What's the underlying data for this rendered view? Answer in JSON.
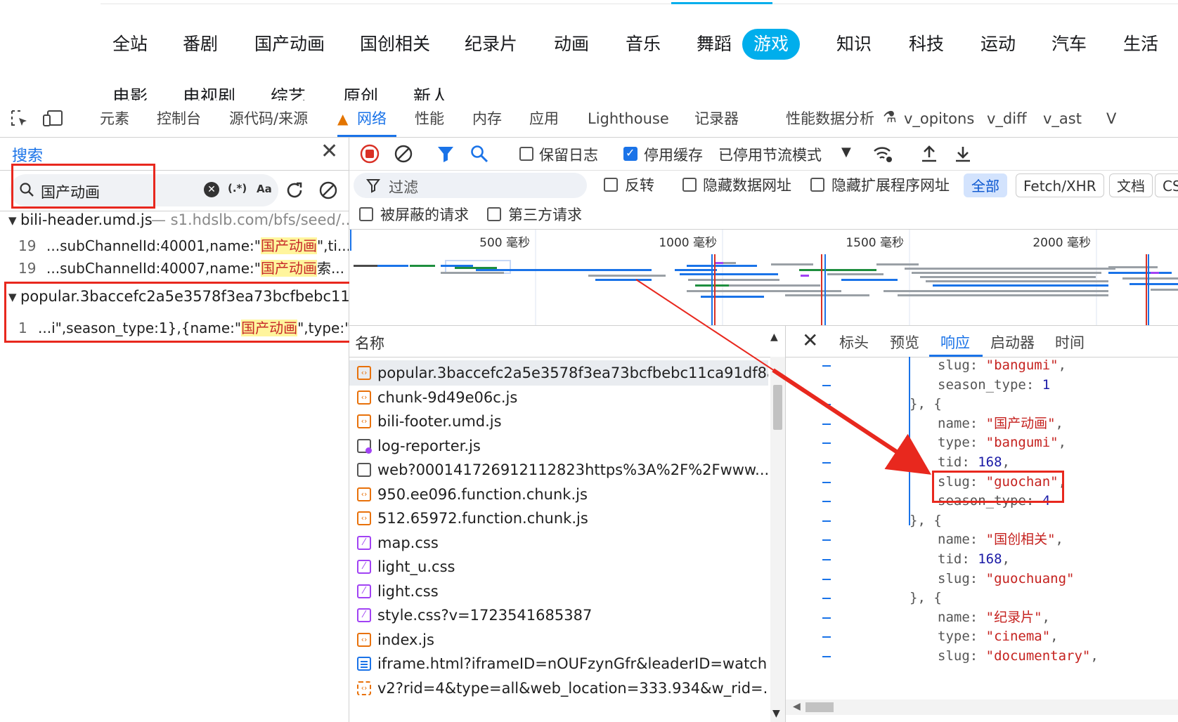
{
  "site_nav": {
    "row1": [
      "全站",
      "番剧",
      "国产动画",
      "国创相关",
      "纪录片",
      "动画",
      "音乐",
      "舞蹈",
      "游戏",
      "知识",
      "科技",
      "运动",
      "汽车",
      "生活"
    ],
    "active": "游戏",
    "row2": [
      "电影",
      "电视剧",
      "综艺",
      "原创",
      "新人"
    ]
  },
  "devtools_tabs": [
    "元素",
    "控制台",
    "源代码/来源",
    "网络",
    "性能",
    "内存",
    "应用",
    "Lighthouse",
    "记录器",
    "性能数据分析",
    "v_opitons",
    "v_diff",
    "v_ast",
    "V"
  ],
  "search_panel": {
    "title": "搜索",
    "query": "国产动画",
    "regex_label": "(.*)",
    "case_label": "Aa",
    "results": [
      {
        "file": "bili-header.umd.js",
        "source": "— s1.hdslb.com/bfs/seed/...",
        "lines": [
          {
            "no": "19",
            "pre": "...subChannelId:40001,name:\"",
            "match": "国产动画",
            "post": "\",ti..."
          },
          {
            "no": "19",
            "pre": "...subChannelId:40007,name:\"",
            "match": "国产动画",
            "post": "索..."
          }
        ]
      },
      {
        "file": "popular.3baccefc2a5e3578f3ea73bcfbebc11c...",
        "source": "",
        "lines": [
          {
            "no": "1",
            "pre": "...i\",season_type:1},{name:\"",
            "match": "国产动画",
            "post": "\",type:\"..."
          }
        ]
      }
    ]
  },
  "network": {
    "toolbar": {
      "preserve_log": "保留日志",
      "disable_cache": "停用缓存",
      "throttle": "已停用节流模式"
    },
    "filter": {
      "placeholder": "过滤",
      "invert": "反转",
      "hide_data": "隐藏数据网址",
      "hide_ext": "隐藏扩展程序网址",
      "types": [
        "全部",
        "Fetch/XHR",
        "文档",
        "CS"
      ],
      "blocked": "被屏蔽的请求",
      "third_party": "第三方请求"
    },
    "timeline_ticks": [
      "500 毫秒",
      "1000 毫秒",
      "1500 毫秒",
      "2000 毫秒"
    ],
    "name_header": "名称",
    "requests": [
      {
        "name": "popular.3baccefc2a5e3578f3ea73bcfbebc11ca91df8a...",
        "icon": "js"
      },
      {
        "name": "chunk-9d49e06c.js",
        "icon": "js"
      },
      {
        "name": "bili-footer.umd.js",
        "icon": "js"
      },
      {
        "name": "log-reporter.js",
        "icon": "doc"
      },
      {
        "name": "web?000141726912112823https%3A%2F%2Fwww....",
        "icon": "blank"
      },
      {
        "name": "950.ee096.function.chunk.js",
        "icon": "js"
      },
      {
        "name": "512.65972.function.chunk.js",
        "icon": "js"
      },
      {
        "name": "map.css",
        "icon": "css"
      },
      {
        "name": "light_u.css",
        "icon": "css"
      },
      {
        "name": "light.css",
        "icon": "css"
      },
      {
        "name": "style.css?v=1723541685387",
        "icon": "css"
      },
      {
        "name": "index.js",
        "icon": "js"
      },
      {
        "name": "iframe.html?iframeID=nOUFzynGfr&leaderID=watch...",
        "icon": "html"
      },
      {
        "name": "v2?rid=4&type=all&web_location=333.934&w_rid=...",
        "icon": "fetch"
      }
    ],
    "detail_tabs": [
      "标头",
      "预览",
      "响应",
      "启动器",
      "时间"
    ],
    "detail_active": "响应",
    "response_lines": [
      {
        "indent": 2,
        "key": "slug",
        "type": "str",
        "val": "\"bangumi\"",
        "tail": ","
      },
      {
        "indent": 2,
        "key": "season_type",
        "type": "num",
        "val": "1",
        "tail": ""
      },
      {
        "indent": 1,
        "text": "}, {"
      },
      {
        "indent": 2,
        "key": "name",
        "type": "str",
        "val": "\"国产动画\"",
        "tail": ","
      },
      {
        "indent": 2,
        "key": "type",
        "type": "str",
        "val": "\"bangumi\"",
        "tail": ","
      },
      {
        "indent": 2,
        "key": "tid",
        "type": "num",
        "val": "168",
        "tail": ","
      },
      {
        "indent": 2,
        "key": "slug",
        "type": "str",
        "val": "\"guochan\"",
        "tail": ","
      },
      {
        "indent": 2,
        "key": "season_type",
        "type": "num",
        "val": "4",
        "tail": ""
      },
      {
        "indent": 1,
        "text": "}, {"
      },
      {
        "indent": 2,
        "key": "name",
        "type": "str",
        "val": "\"国创相关\"",
        "tail": ","
      },
      {
        "indent": 2,
        "key": "tid",
        "type": "num",
        "val": "168",
        "tail": ","
      },
      {
        "indent": 2,
        "key": "slug",
        "type": "str",
        "val": "\"guochuang\"",
        "tail": ""
      },
      {
        "indent": 1,
        "text": "}, {"
      },
      {
        "indent": 2,
        "key": "name",
        "type": "str",
        "val": "\"纪录片\"",
        "tail": ","
      },
      {
        "indent": 2,
        "key": "type",
        "type": "str",
        "val": "\"cinema\"",
        "tail": ","
      },
      {
        "indent": 2,
        "key": "slug",
        "type": "str",
        "val": "\"documentary\"",
        "tail": ","
      }
    ]
  },
  "colors": {
    "accent": "#1a73e8",
    "bili_blue": "#00aeec",
    "annotation_red": "#e8281e",
    "highlight": "#fff59d"
  }
}
